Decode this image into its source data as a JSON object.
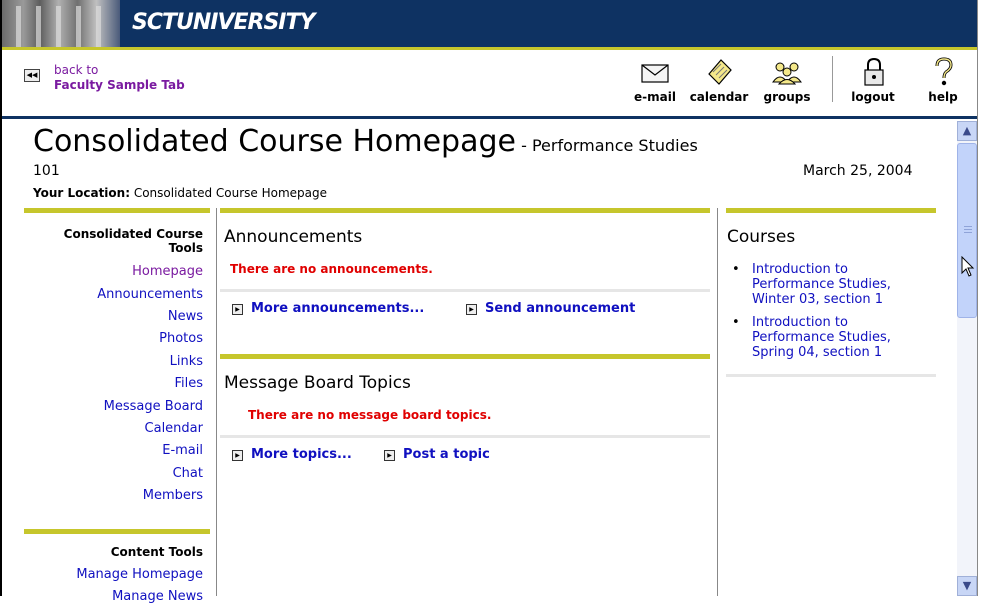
{
  "banner": {
    "title": "SCTUNIVERSITY"
  },
  "toolbar": {
    "back_label": "back to",
    "back_target": "Faculty Sample Tab",
    "tools": [
      {
        "label": "e-mail",
        "icon": "envelope-icon"
      },
      {
        "label": "calendar",
        "icon": "calendar-icon"
      },
      {
        "label": "groups",
        "icon": "groups-icon"
      },
      {
        "label": "logout",
        "icon": "padlock-icon"
      },
      {
        "label": "help",
        "icon": "question-icon"
      }
    ]
  },
  "page": {
    "title": "Consolidated Course Homepage",
    "subtitle": " - Performance Studies",
    "course_num": "101",
    "date": "March 25, 2004",
    "location_label": "Your Location:",
    "location_value": " Consolidated Course Homepage"
  },
  "nav": {
    "course_tools_heading": "Consolidated Course Tools",
    "course_tools": [
      "Homepage",
      "Announcements",
      "News",
      "Photos",
      "Links",
      "Files",
      "Message Board",
      "Calendar",
      "E-mail",
      "Chat",
      "Members"
    ],
    "content_tools_heading": "Content Tools",
    "content_tools": [
      "Manage Homepage",
      "Manage News"
    ]
  },
  "announcements": {
    "title": "Announcements",
    "empty_message": "There are no announcements.",
    "more_link": "More announcements...",
    "send_link": "Send announcement"
  },
  "message_board": {
    "title": "Message Board Topics",
    "empty_message": "There are no message board topics.",
    "more_link": "More topics...",
    "post_link": "Post a topic"
  },
  "courses": {
    "title": "Courses",
    "items": [
      "Introduction to Performance Studies, Winter 03, section 1",
      "Introduction to Performance Studies, Spring 04, section 1"
    ]
  },
  "colors": {
    "banner": "#0e3262",
    "accent_yellow": "#c6c62c",
    "link": "#1010c0",
    "visited": "#7a1aa0",
    "alert": "#e00000"
  }
}
